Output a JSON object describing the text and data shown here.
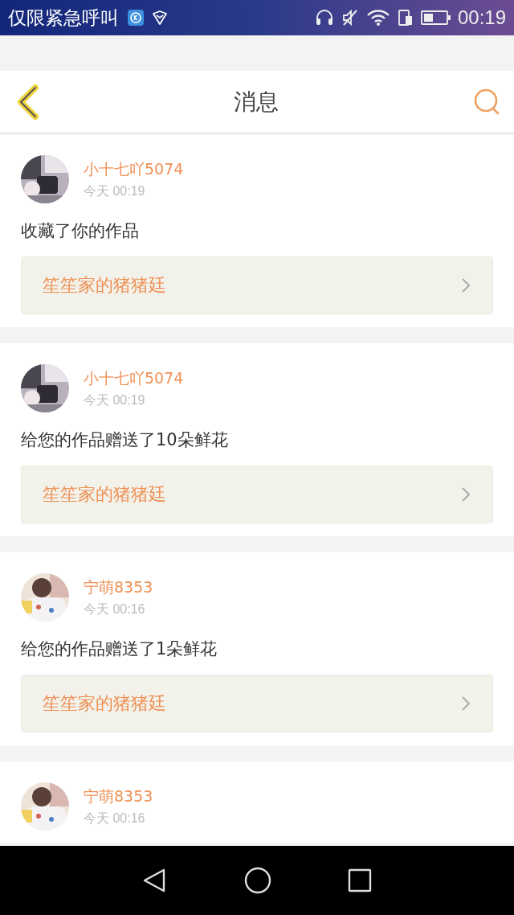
{
  "status_bar": {
    "carrier": "仅限紧急呼叫",
    "time": "00:19"
  },
  "header": {
    "title": "消息"
  },
  "messages": [
    {
      "name": "小十七吖5074",
      "time": "今天 00:19",
      "text": "收藏了你的作品",
      "work": "笙笙家的猪猪廷"
    },
    {
      "name": "小十七吖5074",
      "time": "今天 00:19",
      "text": "给您的作品赠送了10朵鲜花",
      "work": "笙笙家的猪猪廷"
    },
    {
      "name": "宁萌8353",
      "time": "今天 00:16",
      "text": "给您的作品赠送了1朵鲜花",
      "work": "笙笙家的猪猪廷"
    },
    {
      "name": "宁萌8353",
      "time": "今天 00:16"
    }
  ]
}
